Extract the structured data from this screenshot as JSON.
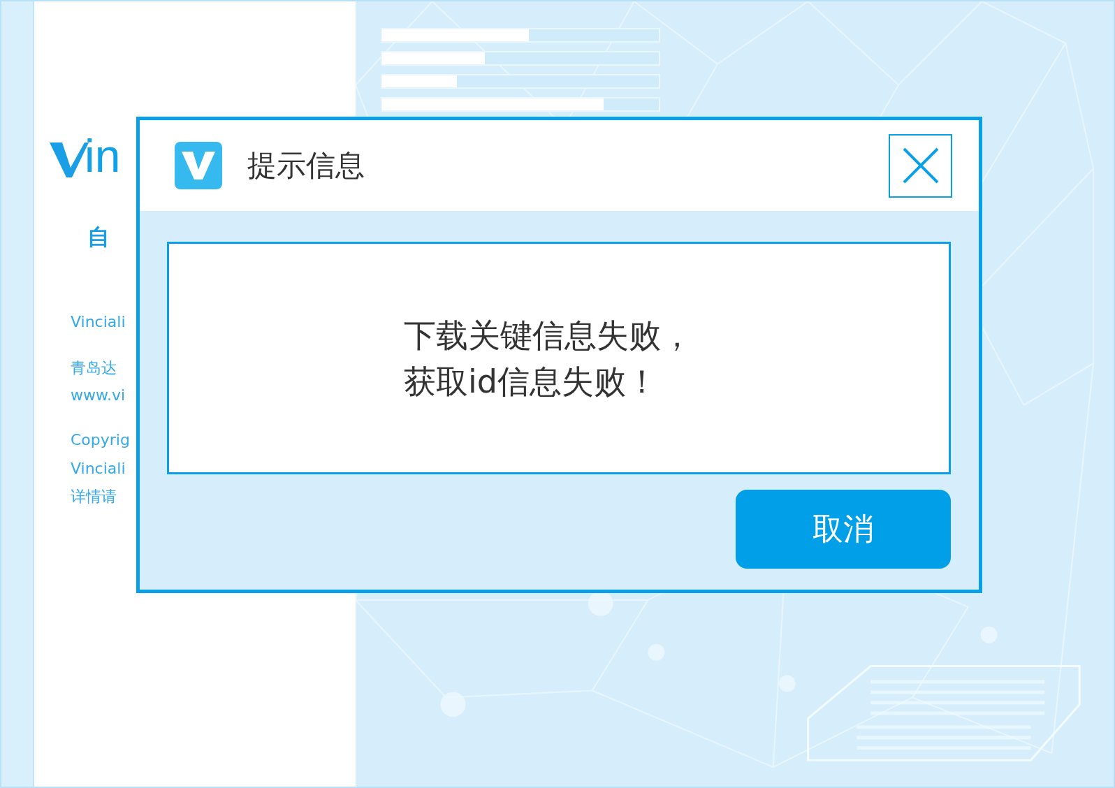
{
  "side_panel": {
    "logo_text": "in",
    "heading": "自",
    "lines": [
      "Vinciali",
      "青岛达",
      "www.vi",
      "Copyrig",
      "Vinciali",
      "详情请"
    ]
  },
  "progress_bars": [
    {
      "level": 0.53
    },
    {
      "level": 0.37
    },
    {
      "level": 0.27
    },
    {
      "level": 0.8
    }
  ],
  "dialog": {
    "title": "提示信息",
    "message": [
      "下载关键信息失败，",
      "获取id信息失败！"
    ],
    "buttons": [
      "取消"
    ]
  }
}
